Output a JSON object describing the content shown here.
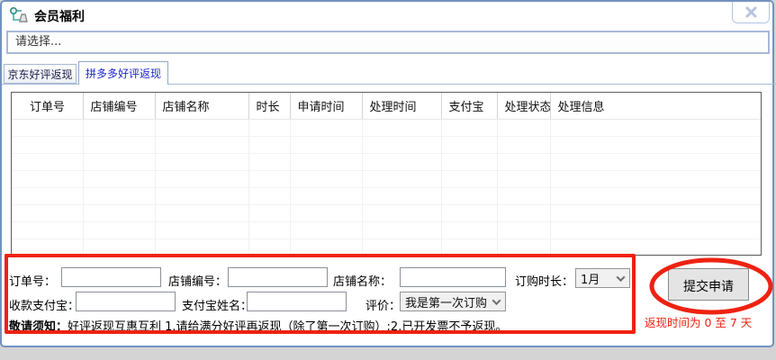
{
  "window": {
    "title": "会员福利"
  },
  "selector": {
    "value": "请选择..."
  },
  "tabs": [
    {
      "label": "京东好评返现",
      "active": false
    },
    {
      "label": "拼多多好评返现",
      "active": true
    }
  ],
  "table": {
    "columns": [
      "订单号",
      "店铺编号",
      "店铺名称",
      "时长",
      "申请时间",
      "处理时间",
      "支付宝",
      "处理状态",
      "处理信息"
    ],
    "rows": []
  },
  "form": {
    "fields": {
      "order_no": {
        "label": "订单号：",
        "value": ""
      },
      "shop_id": {
        "label": "店铺编号：",
        "value": ""
      },
      "shop_name": {
        "label": "店铺名称：",
        "value": ""
      },
      "duration": {
        "label": "订购时长：",
        "value": "1月"
      },
      "alipay_account": {
        "label": "收款支付宝：",
        "value": ""
      },
      "alipay_name": {
        "label": "支付宝姓名：",
        "value": ""
      },
      "rating": {
        "label": "评价：",
        "value": "我是第一次订购"
      }
    },
    "notice": {
      "lead": "敬请须知：",
      "body": "好评返现互惠互利 1.请给满分好评再返现（除了第一次订购）;2.已开发票不予返现。"
    },
    "submit_label": "提交申请",
    "cashback_note": "返现时间为 0 至 7 天"
  },
  "colors": {
    "annotation_red": "#ee2211",
    "active_tab_blue": "#2026d2",
    "window_border_blue": "#7292c0"
  }
}
